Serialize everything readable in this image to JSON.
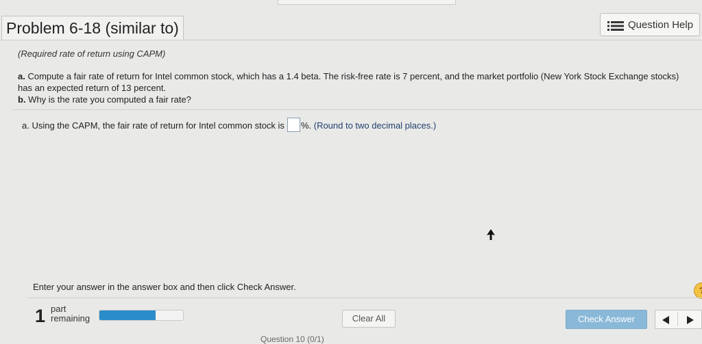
{
  "header": {
    "title": "Problem 6-18 (similar to)",
    "help_button": "Question Help",
    "help_icon": "list-icon"
  },
  "problem": {
    "subtitle": "(Required rate of return using CAPM)",
    "part_a_letter": "a.",
    "part_a_text": " Compute a fair rate of return for Intel common stock, which has a 1.4 beta. The risk-free rate is 7 percent, and the market portfolio (New York Stock Exchange stocks) has an expected return of 13 percent.",
    "part_b_letter": "b.",
    "part_b_text": " Why is the rate you computed a fair rate?"
  },
  "answer": {
    "prefix": "a. Using the CAPM, the fair rate of return for Intel common stock is",
    "suffix": "%.",
    "hint": "(Round to two decimal places.)",
    "value": ""
  },
  "footer": {
    "instructions": "Enter your answer in the answer box and then click Check Answer.",
    "parts_remaining_count": "1",
    "parts_label_1": "part",
    "parts_label_2": "remaining",
    "progress_fraction": 0.67,
    "clear_all": "Clear All",
    "check_answer": "Check Answer",
    "help_circle": "?",
    "question_label": "Question 10 (0/1)"
  },
  "colors": {
    "progress_fill": "#2a8cc8",
    "check_button": "#8ab8d8",
    "help_circle": "#f2c241"
  }
}
